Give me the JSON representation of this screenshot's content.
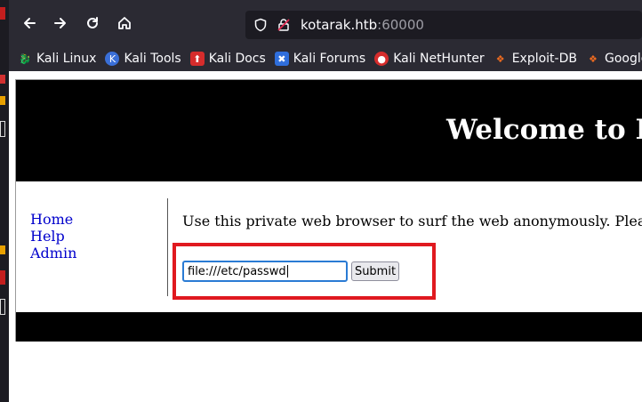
{
  "browser": {
    "url_host": "kotarak.htb",
    "url_port": ":60000",
    "bookmarks": [
      {
        "label": "Kali Linux",
        "icon": "kali-linux-icon"
      },
      {
        "label": "Kali Tools",
        "icon": "kali-tools-icon"
      },
      {
        "label": "Kali Docs",
        "icon": "kali-docs-icon"
      },
      {
        "label": "Kali Forums",
        "icon": "kali-forums-icon"
      },
      {
        "label": "Kali NetHunter",
        "icon": "kali-nethunter-icon"
      },
      {
        "label": "Exploit-DB",
        "icon": "exploit-db-icon"
      },
      {
        "label": "Google H",
        "icon": "google-hacking-icon"
      }
    ]
  },
  "page": {
    "title": "Welcome to K",
    "menu": [
      "Home",
      "Help",
      "Admin"
    ],
    "intro": "Use this private web browser to surf the web anonymously. Plea",
    "url_field_value": "file:///etc/passwd",
    "submit_label": "Submit"
  },
  "colors": {
    "highlight": "#e0191f",
    "link": "#0000cc",
    "chrome": "#2b2a33"
  }
}
